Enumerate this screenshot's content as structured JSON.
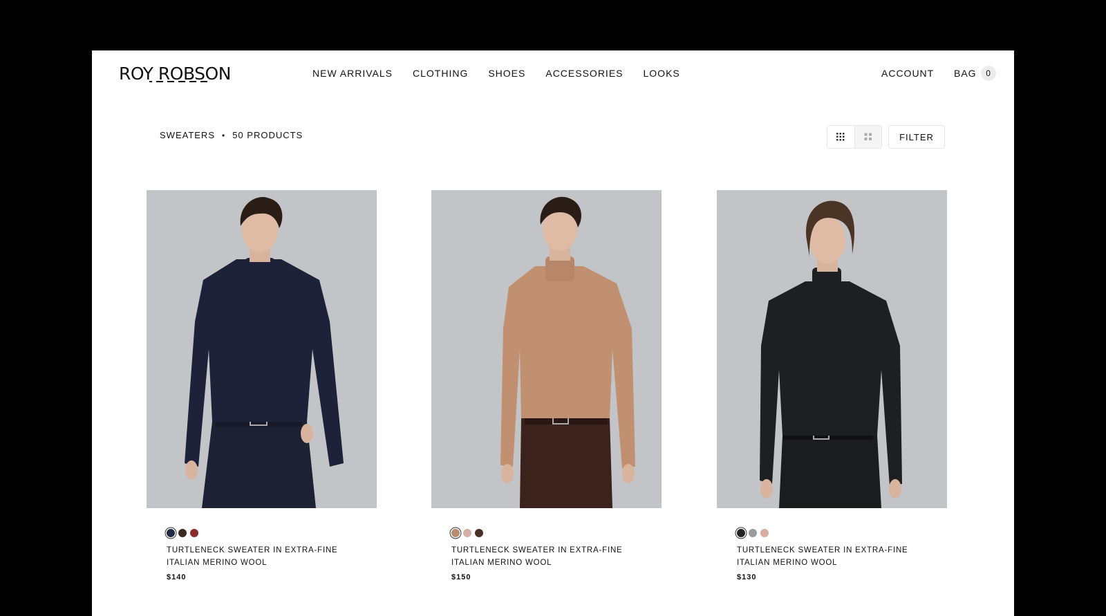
{
  "brand": {
    "logo": "ROY ROBSON"
  },
  "nav": {
    "items": [
      "NEW ARRIVALS",
      "CLOTHING",
      "SHOES",
      "ACCESSORIES",
      "LOOKS"
    ]
  },
  "header": {
    "account": "ACCOUNT",
    "bag_label": "BAG",
    "bag_count": "0"
  },
  "toolbar": {
    "category": "SWEATERS",
    "separator": "•",
    "count": "50 PRODUCTS",
    "filter_label": "FILTER",
    "view_icons": [
      "grid-9-icon",
      "grid-4-icon"
    ]
  },
  "products": [
    {
      "name_line1": "TURTLENECK SWEATER IN EXTRA-FINE",
      "name_line2": "ITALIAN MERINO WOOL",
      "price": "$140",
      "swatches": [
        "#1f2a44",
        "#3a2a22",
        "#8b2c2c"
      ],
      "sweater_color": "#1d2238",
      "pants_color": "#1c2133"
    },
    {
      "name_line1": "TURTLENECK SWEATER IN EXTRA-FINE",
      "name_line2": "ITALIAN MERINO WOOL",
      "price": "$150",
      "swatches": [
        "#b98a6b",
        "#d4b0a4",
        "#4a3026"
      ],
      "sweater_color": "#c09070",
      "pants_color": "#3b221c"
    },
    {
      "name_line1": "TURTLENECK SWEATER IN EXTRA-FINE",
      "name_line2": "ITALIAN MERINO WOOL",
      "price": "$130",
      "swatches": [
        "#222222",
        "#9a9a9a",
        "#d7ad9f"
      ],
      "sweater_color": "#1e1f21",
      "pants_color": "#1b1c1e"
    }
  ]
}
